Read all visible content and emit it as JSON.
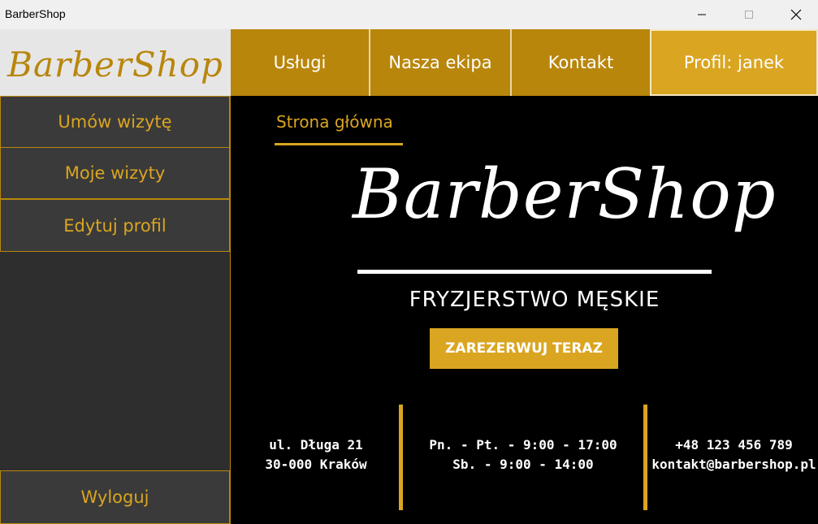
{
  "window": {
    "title": "BarberShop",
    "controls": [
      "minimize-icon",
      "maximize-icon",
      "close-icon"
    ]
  },
  "brand": {
    "logo_text": "BarberShop"
  },
  "topnav": {
    "uslugi": "Usługi",
    "ekipa": "Nasza ekipa",
    "kontakt": "Kontakt",
    "profil": "Profil: janek"
  },
  "sidebar": {
    "umow": "Umów wizytę",
    "moje": "Moje wizyty",
    "edytuj": "Edytuj profil",
    "wyloguj": "Wyloguj"
  },
  "main": {
    "breadcrumb": "Strona główna",
    "hero_logo": "BarberShop",
    "tagline": "FRYZJERSTWO MĘSKIE",
    "cta": "ZAREZERWUJ TERAZ"
  },
  "info": {
    "address_line1": "ul. Długa 21",
    "address_line2": "30-000 Kraków",
    "hours_line1": "Pn. - Pt. - 9:00 - 17:00",
    "hours_line2": "Sb. - 9:00 - 14:00",
    "phone": "+48 123 456 789",
    "email": "kontakt@barbershop.pl"
  },
  "colors": {
    "gold": "#daa520",
    "dark_gold": "#b8860b",
    "sidebar_bg": "#2e2e2e",
    "main_bg": "#000000"
  }
}
